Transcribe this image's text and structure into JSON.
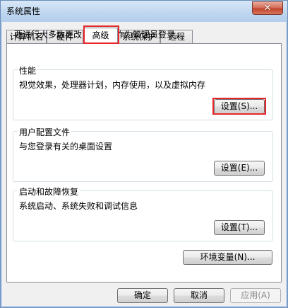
{
  "window": {
    "title": "系统属性",
    "close_glyph": "✕"
  },
  "tabs": [
    {
      "label": "计算机名",
      "active": false
    },
    {
      "label": "硬件",
      "active": false
    },
    {
      "label": "高级",
      "active": true
    },
    {
      "label": "系统保护",
      "active": false
    },
    {
      "label": "远程",
      "active": false
    }
  ],
  "advanced": {
    "admin_note": "要进行大多数更改，您必须作为管理员登录。",
    "performance": {
      "title": "性能",
      "description": "视觉效果，处理器计划，内存使用，以及虚拟内存",
      "button": "设置(S)..."
    },
    "user_profiles": {
      "title": "用户配置文件",
      "description": "与您登录有关的桌面设置",
      "button": "设置(E)..."
    },
    "startup_recovery": {
      "title": "启动和故障恢复",
      "description": "系统启动、系统失败和调试信息",
      "button": "设置(T)..."
    },
    "env_vars_button": "环境变量(N)..."
  },
  "footer": {
    "ok": "确定",
    "cancel": "取消",
    "apply": "应用(A)"
  },
  "colors": {
    "highlight": "#e8262a",
    "title_gradient_top": "#d9e8f8",
    "close_button": "#c2442c"
  }
}
